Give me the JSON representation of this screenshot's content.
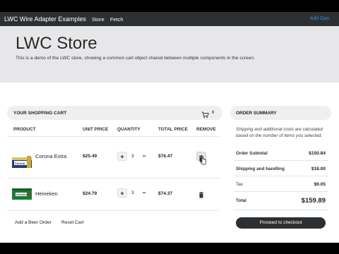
{
  "navbar": {
    "title": "LWC Wire Adapter Examples",
    "links": [
      "Store",
      "Fetch"
    ],
    "right_link": "Add Gas"
  },
  "hero": {
    "title": "LWC Store",
    "description": "This is a demo of the LWC store, showing a common cart object shared between multiple components in the screen."
  },
  "cart": {
    "title": "YOUR SHOPPING CART",
    "count": "6",
    "columns": [
      "PRODUCT",
      "UNIT PRICE",
      "QUANTITY",
      "TOTAL PRICE",
      "REMOVE"
    ],
    "items": [
      {
        "name": "Corona Extra",
        "unit_price": "$25.49",
        "quantity": "3",
        "total_price": "$76.47"
      },
      {
        "name": "Heineken",
        "unit_price": "$24.79",
        "quantity": "3",
        "total_price": "$74.37"
      }
    ],
    "plus_label": "+",
    "minus_label": "−",
    "add_beer_label": "Add a Beer Order",
    "reset_label": "Reset Cart"
  },
  "summary": {
    "title": "ORDER SUMMARY",
    "note": "Shipping and additional costs are calculated based on the number of items you selected.",
    "rows": [
      {
        "label": "Order Subtotal",
        "value": "$150.84"
      },
      {
        "label": "Shipping and handling",
        "value": "$18.00"
      },
      {
        "label": "Tax",
        "value": "$9.05"
      }
    ],
    "total_label": "Total",
    "total_value": "$159.89",
    "checkout_label": "Proceed to checkout"
  },
  "colors": {
    "navbar_bg": "#2d3033",
    "hero_bg": "#e7e7ea",
    "accent_link": "#3e8ad8"
  },
  "icons": [
    "cart-icon",
    "trash-icon",
    "cursor-icon"
  ]
}
